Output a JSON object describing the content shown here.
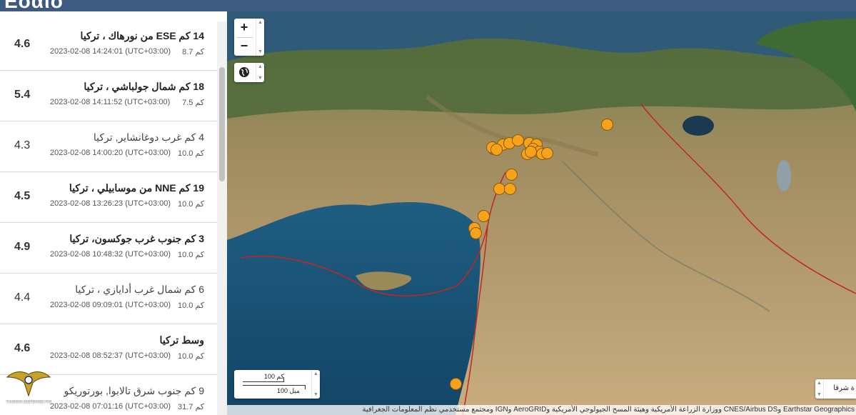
{
  "header": {
    "logo_text": "Εοαιό"
  },
  "earthquakes": [
    {
      "mag": "4.6",
      "title": "14 كم ESE من نورهاك ، تركيا",
      "depth": "8.7 كم",
      "time": "2023-02-08 14:24:01 (UTC+03:00)",
      "emphasis": "bold"
    },
    {
      "mag": "5.4",
      "title": "18 كم شمال جولباشي ، تركيا",
      "depth": "7.5 كم",
      "time": "2023-02-08 14:11:52 (UTC+03:00)",
      "emphasis": "bold"
    },
    {
      "mag": "4.3",
      "title": "4 كم غرب دوغانشاير, تركيا",
      "depth": "10.0 كم",
      "time": "2023-02-08 14:00:20 (UTC+03:00)",
      "emphasis": "normal"
    },
    {
      "mag": "4.5",
      "title": "19 كم NNE من موسابيلي ، تركيا",
      "depth": "10.0 كم",
      "time": "2023-02-08 13:26:23 (UTC+03:00)",
      "emphasis": "bold"
    },
    {
      "mag": "4.9",
      "title": "3 كم جنوب غرب جوكسون، تركيا",
      "depth": "10.0 كم",
      "time": "2023-02-08 10:48:32 (UTC+03:00)",
      "emphasis": "bold"
    },
    {
      "mag": "4.4",
      "title": "6 كم شمال غرب أدايازي ، تركيا",
      "depth": "10.0 كم",
      "time": "2023-02-08 09:09:01 (UTC+03:00)",
      "emphasis": "normal"
    },
    {
      "mag": "4.6",
      "title": "وسط تركيا",
      "depth": "10.0 كم",
      "time": "2023-02-08 08:52:37 (UTC+03:00)",
      "emphasis": "bold"
    },
    {
      "mag": "",
      "title": "9 كم جنوب شرق تالابوا, بورتوريكو",
      "depth": "31.7 كم",
      "time": "2023-02-08 07:01:16 (UTC+03:00)",
      "emphasis": "normal"
    }
  ],
  "map": {
    "zoom_in_label": "+",
    "zoom_out_label": "−",
    "globe_icon": "globe-icon",
    "scale_km": "100 كم",
    "scale_mi": "100 ميل",
    "legend_text": "ة شرقا",
    "attribution": "Earthstar Geographics وCNES/Airbus DS ووزارة الزراعة الأمريكية وهيئة المسح الجيولوجي الأمريكية وAeroGRID وIGN ومجتمع مستخدمي نظم المعلومات الجغرافية",
    "marker_color": "#f7a21b",
    "fault_color": "#c0281e"
  },
  "watermark": {
    "text": "TUNISIA DEFENSE FORUM"
  }
}
